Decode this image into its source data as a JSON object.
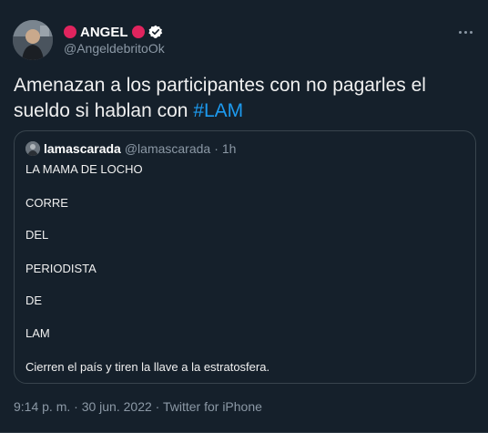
{
  "author": {
    "name": "ANGEL",
    "handle": "@AngeldebritoOk",
    "verified": true,
    "emoji_color": "#e0245e"
  },
  "tweet": {
    "text_before": "Amenazan a los participantes con no pagarles el sueldo si hablan con ",
    "hashtag": "#LAM"
  },
  "quoted": {
    "name": "lamascarada",
    "handle": "@lamascarada",
    "separator": "·",
    "time": "1h",
    "lines": [
      "LA MAMA DE LOCHO",
      "CORRE",
      "DEL",
      "PERIODISTA",
      "DE",
      "LAM",
      "Cierren el país y tiren la llave a la estratosfera."
    ]
  },
  "footer": {
    "timestamp": "9:14 p. m. · 30 jun. 2022",
    "separator": "·",
    "source": "Twitter for iPhone"
  },
  "colors": {
    "background": "#15202b",
    "link": "#1d9bf0",
    "muted": "#8b98a5",
    "border": "#38444d"
  }
}
